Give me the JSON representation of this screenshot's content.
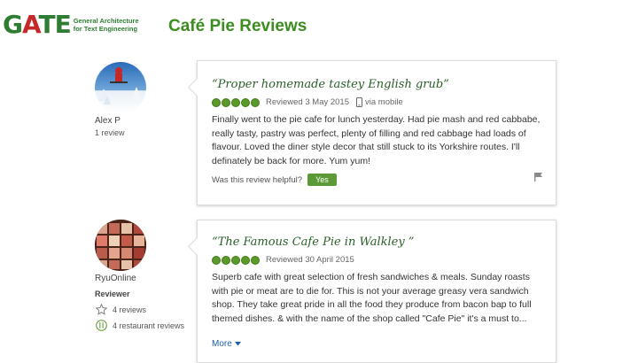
{
  "header": {
    "logo_word": "GATE",
    "logo_sub_line1": "General Architecture",
    "logo_sub_line2": "for Text Engineering",
    "page_title": "Café Pie Reviews"
  },
  "reviews": [
    {
      "reviewer_name": "Alex P",
      "reviewer_count": "1 review",
      "quote": "“Proper homemade tastey English grub”",
      "rating": 5,
      "reviewed": "Reviewed 3 May 2015",
      "via": "via mobile",
      "body": "Finally went to the pie cafe for lunch yesterday. Had pie mash and red cabbabe, really tasty, pastry was perfect, plenty of filling and red cabbage had loads of flavour. Loved the diner style decor that still stuck to its Yorkshire routes. I'll definately be back for more. Yum yum!",
      "helpful_label": "Was this review helpful?",
      "yes_label": "Yes"
    },
    {
      "reviewer_name": "RyuOnline",
      "reviewer_level": "Reviewer",
      "reviews_count": "4 reviews",
      "restaurant_reviews_count": "4 restaurant reviews",
      "quote": "“The Famous Cafe Pie in Walkley ”",
      "rating": 5,
      "reviewed": "Reviewed 30 April 2015",
      "body": "Superb cafe with great selection of fresh sandwiches & meals. Sunday roasts with pie or meat are to die for. This is not your average greasy vera sandwich shop. They take great pride in all the food they produce from bacon bap to full themed dishes. & with the name of the shop called \"Cafe Pie\" it's a must to...",
      "more_label": "More"
    }
  ],
  "colors": {
    "title_green": "#3c8d1f",
    "quote_green": "#2a5e2a",
    "rating_green": "#5b9a2a",
    "yes_button": "#5b9a36",
    "link_blue": "#1a5faa"
  }
}
